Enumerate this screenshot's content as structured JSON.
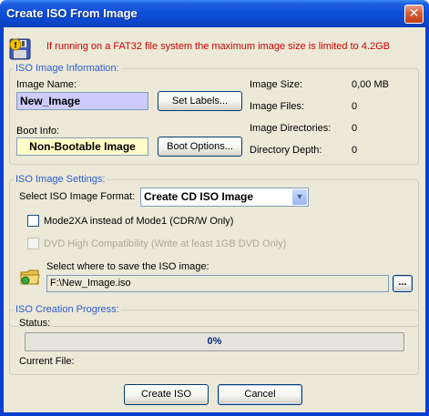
{
  "window": {
    "title": "Create ISO From Image",
    "close_glyph": "✕"
  },
  "warning": {
    "icon": "floppy-warning-icon",
    "text": "If running on a FAT32 file system the maximum image size is limited to 4.2GB"
  },
  "info": {
    "group_title": "ISO Image Information:",
    "image_name_label": "Image Name:",
    "image_name_value": "New_Image",
    "set_labels_button": "Set Labels...",
    "boot_info_label": "Boot Info:",
    "boot_info_value": "Non-Bootable Image",
    "boot_options_button": "Boot Options...",
    "stats": [
      {
        "label": "Image Size:",
        "value": "0,00 MB"
      },
      {
        "label": "Image Files:",
        "value": "0"
      },
      {
        "label": "Image Directories:",
        "value": "0"
      },
      {
        "label": "Directory Depth:",
        "value": "0"
      }
    ]
  },
  "settings": {
    "group_title": "ISO Image Settings:",
    "format_label": "Select ISO Image Format:",
    "format_value": "Create CD ISO Image",
    "mode2xa_label": "Mode2XA instead of Mode1 (CDR/W Only)",
    "dvd_compat_label": "DVD High Compatibility (Write at least 1GB DVD Only)",
    "save_label": "Select where to save the ISO image:",
    "save_path": "F:\\New_Image.iso",
    "browse_button": "..."
  },
  "progress": {
    "group_title": "ISO Creation Progress:",
    "status_label": "Status:",
    "percent_text": "0%",
    "percent_value": 0,
    "current_file_label": "Current File:"
  },
  "actions": {
    "create_button": "Create ISO",
    "cancel_button": "Cancel"
  },
  "colors": {
    "title_bar": "#0f4fd8",
    "warning_text": "#cc0000",
    "group_title": "#2d5bd4",
    "name_field": "#ccccff",
    "boot_field": "#ffffc8"
  }
}
